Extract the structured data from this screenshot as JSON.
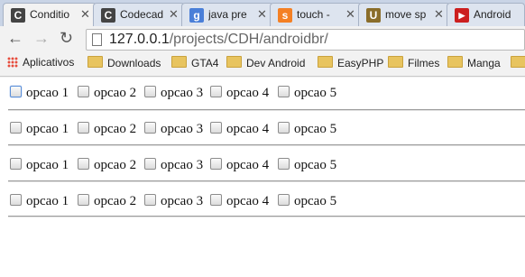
{
  "browser": {
    "tabs": [
      {
        "title": "Conditio",
        "favicon": "C",
        "color": "#444444"
      },
      {
        "title": "Codecad",
        "favicon": "C",
        "color": "#444444"
      },
      {
        "title": "java pre",
        "favicon": "g",
        "color": "#4a7fd8"
      },
      {
        "title": "touch -",
        "favicon": "s",
        "color": "#f48024"
      },
      {
        "title": "move sp",
        "favicon": "U",
        "color": "#8a6d2a"
      },
      {
        "title": "Android",
        "favicon": "▶",
        "color": "#cc1f1f"
      }
    ],
    "url_host": "127.0.0.1",
    "url_path": "/projects/CDH/androidbr/",
    "bookmarks": [
      "Aplicativos",
      "Downloads",
      "GTA4",
      "Dev Android",
      "EasyPHP",
      "Filmes",
      "Manga"
    ]
  },
  "rows": [
    {
      "options": [
        "opcao 1",
        "opcao 2",
        "opcao 3",
        "opcao 4",
        "opcao 5"
      ]
    },
    {
      "options": [
        "opcao 1",
        "opcao 2",
        "opcao 3",
        "opcao 4",
        "opcao 5"
      ]
    },
    {
      "options": [
        "opcao 1",
        "opcao 2",
        "opcao 3",
        "opcao 4",
        "opcao 5"
      ]
    },
    {
      "options": [
        "opcao 1",
        "opcao 2",
        "opcao 3",
        "opcao 4",
        "opcao 5"
      ]
    }
  ]
}
